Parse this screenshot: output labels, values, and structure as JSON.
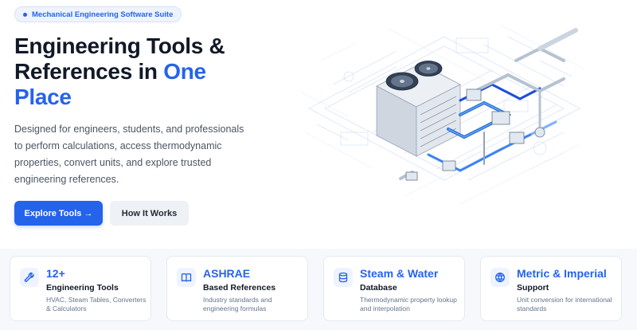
{
  "hero": {
    "badge": "Mechanical Engineering Software Suite",
    "headline_part1": "Engineering Tools &",
    "headline_part2": "References in",
    "headline_accent1": "One",
    "headline_accent2": "Place",
    "description": "Designed for engineers, students, and professionals to perform calculations, access thermodynamic properties, convert units, and explore trusted engineering references.",
    "primary_button": "Explore Tools →",
    "secondary_button": "How It Works",
    "illustration_icon": "hvac-condenser-piping-blueprint"
  },
  "stats": [
    {
      "icon": "wrench-icon",
      "title": "12+",
      "subtitle": "Engineering Tools",
      "detail": "HVAC, Steam Tables, Converters & Calculators"
    },
    {
      "icon": "book-icon",
      "title": "ASHRAE",
      "subtitle": "Based References",
      "detail": "Industry standards and engineering formulas"
    },
    {
      "icon": "database-icon",
      "title": "Steam & Water",
      "subtitle": "Database",
      "detail": "Thermodynamic property lookup and interpolation"
    },
    {
      "icon": "globe-icon",
      "title": "Metric & Imperial",
      "subtitle": "Support",
      "detail": "Unit conversion for international standards"
    }
  ],
  "colors": {
    "accent": "#2563eb",
    "text": "#111827",
    "muted": "#64748b"
  }
}
